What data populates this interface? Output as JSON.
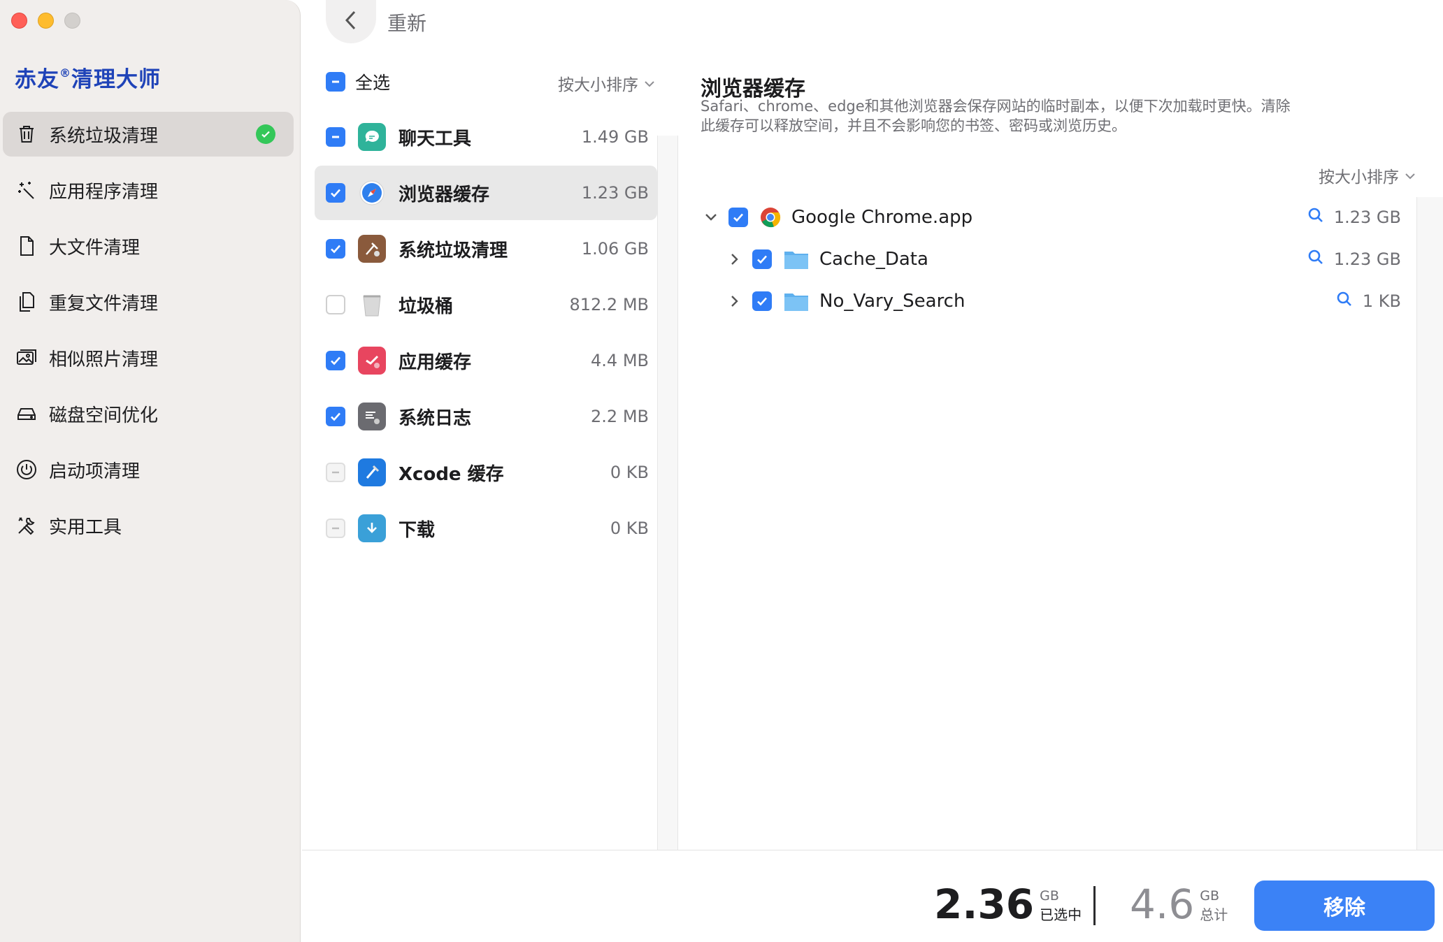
{
  "app": {
    "brand_prefix": "赤友",
    "brand_mark": "®",
    "brand_suffix": "清理大师"
  },
  "sidebar": {
    "items": [
      {
        "label": "系统垃圾清理",
        "icon": "trash-icon",
        "active": true
      },
      {
        "label": "应用程序清理",
        "icon": "magic-wand-icon"
      },
      {
        "label": "大文件清理",
        "icon": "document-icon"
      },
      {
        "label": "重复文件清理",
        "icon": "duplicate-files-icon"
      },
      {
        "label": "相似照片清理",
        "icon": "photos-icon"
      },
      {
        "label": "磁盘空间优化",
        "icon": "disk-icon"
      },
      {
        "label": "启动项清理",
        "icon": "power-icon"
      },
      {
        "label": "实用工具",
        "icon": "tools-icon"
      }
    ]
  },
  "header": {
    "title": "重新",
    "back_icon": "chevron-left-icon"
  },
  "list": {
    "select_all_label": "全选",
    "sort_label": "按大小排序",
    "items": [
      {
        "label": "聊天工具",
        "size": "1.49 GB",
        "state": "partial",
        "icon": "chat-icon",
        "color": "#2fb39a"
      },
      {
        "label": "浏览器缓存",
        "size": "1.23 GB",
        "state": "checked",
        "icon": "safari-icon",
        "color": "#2f80ed",
        "selected": true
      },
      {
        "label": "系统垃圾清理",
        "size": "1.06 GB",
        "state": "checked",
        "icon": "system-junk-icon",
        "color": "#8a5a3c"
      },
      {
        "label": "垃圾桶",
        "size": "812.2 MB",
        "state": "empty",
        "icon": "trash-bin-icon",
        "color": "#d5d5d5"
      },
      {
        "label": "应用缓存",
        "size": "4.4 MB",
        "state": "checked",
        "icon": "app-cache-icon",
        "color": "#e8455f"
      },
      {
        "label": "系统日志",
        "size": "2.2 MB",
        "state": "checked",
        "icon": "log-icon",
        "color": "#6b6b70"
      },
      {
        "label": "Xcode 缓存",
        "size": "0 KB",
        "state": "disabled",
        "icon": "xcode-icon",
        "color": "#1f7ae0"
      },
      {
        "label": "下载",
        "size": "0 KB",
        "state": "disabled",
        "icon": "downloads-icon",
        "color": "#3aa0d8"
      }
    ]
  },
  "detail": {
    "title": "浏览器缓存",
    "description": "Safari、chrome、edge和其他浏览器会保存网站的临时副本，以便下次加载时更快。清除此缓存可以释放空间，并且不会影响您的书签、密码或浏览历史。",
    "sort_label": "按大小排序",
    "tree": [
      {
        "name": "Google Chrome.app",
        "size": "1.23 GB",
        "level": 0,
        "expanded": true,
        "icon": "chrome-icon"
      },
      {
        "name": "Cache_Data",
        "size": "1.23 GB",
        "level": 1,
        "expanded": false,
        "icon": "folder-icon"
      },
      {
        "name": "No_Vary_Search",
        "size": "1 KB",
        "level": 1,
        "expanded": false,
        "icon": "folder-icon"
      }
    ]
  },
  "footer": {
    "selected_value": "2.36",
    "selected_unit": "GB",
    "selected_label": "已选中",
    "total_value": "4.6",
    "total_unit": "GB",
    "total_label": "总计",
    "remove_label": "移除"
  },
  "colors": {
    "accent": "#2f7cf6",
    "brand": "#1f43b8",
    "success": "#34c759",
    "button": "#3b82f6"
  }
}
